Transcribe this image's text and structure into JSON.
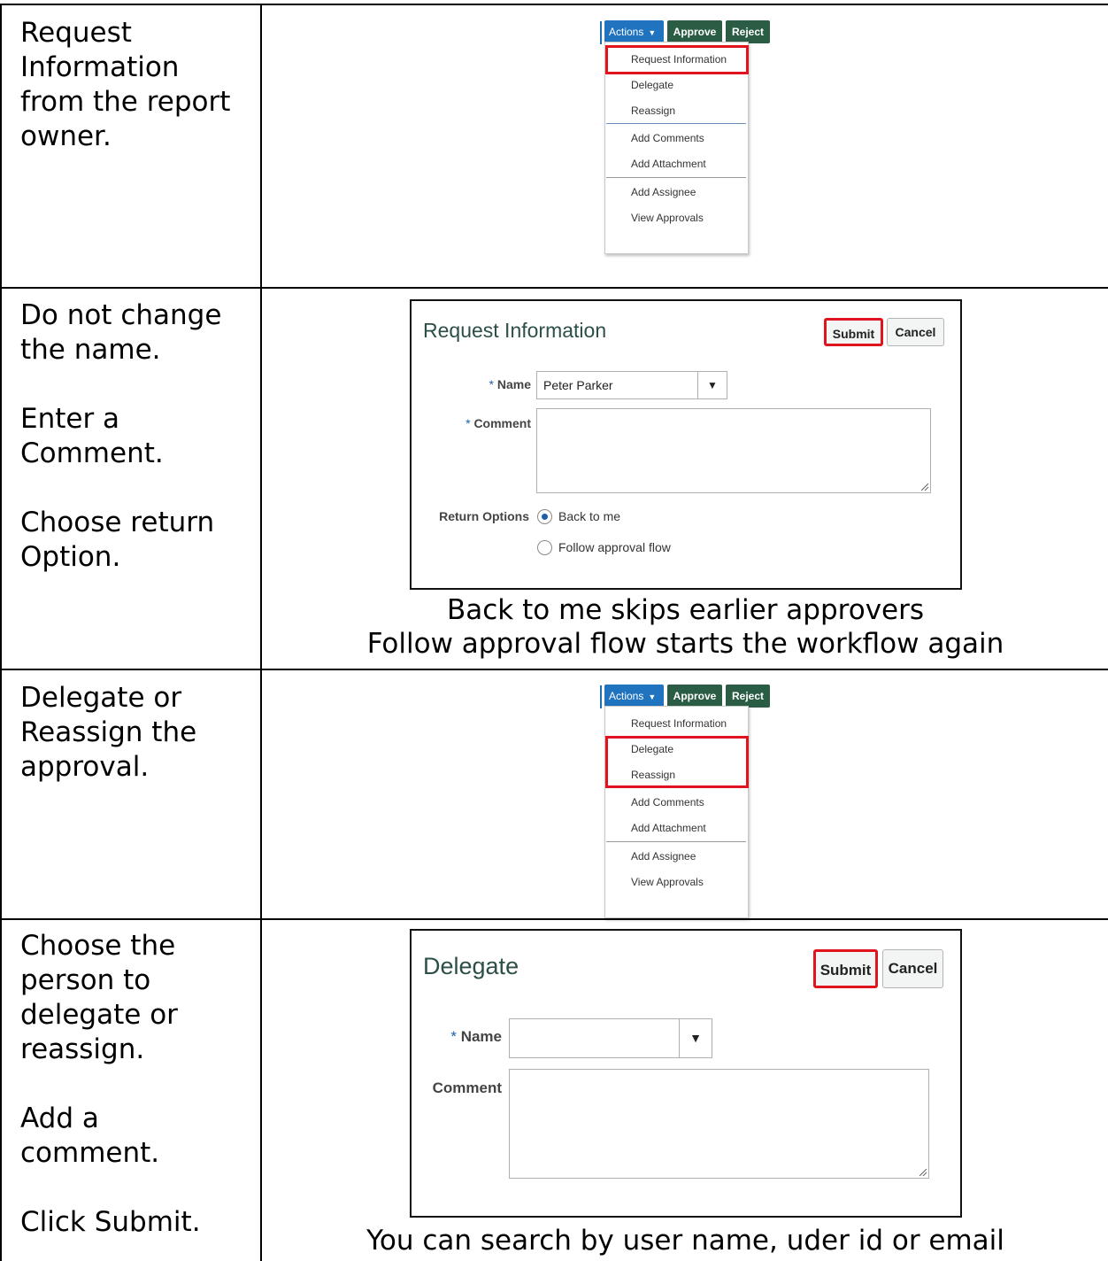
{
  "rows": [
    {
      "instruction": [
        "Request",
        "Information",
        "from the report",
        "owner."
      ]
    },
    {
      "instruction": [
        "Do not change",
        "the name."
      ],
      "instruction_2": [
        "Enter a",
        "Comment."
      ],
      "instruction_3": [
        "Choose return",
        "Option."
      ],
      "caption_1": "Back to me skips earlier approvers",
      "caption_2": "Follow approval flow starts the workflow again"
    },
    {
      "instruction": [
        "Delegate or",
        "Reassign the",
        "approval."
      ]
    },
    {
      "instruction": [
        "Choose the",
        "person to",
        "delegate or",
        "reassign."
      ],
      "instruction_2": [
        "Add a",
        "comment."
      ],
      "instruction_3": [
        "Click Submit."
      ],
      "caption_1": "You can search by user name, uder id or email"
    }
  ],
  "actions_menu": {
    "actions_label": "Actions",
    "approve_label": "Approve",
    "reject_label": "Reject",
    "items": [
      "Request Information",
      "Delegate",
      "Reassign",
      "Add Comments",
      "Add Attachment",
      "Add Assignee",
      "View Approvals"
    ]
  },
  "request_info_dialog": {
    "title": "Request Information",
    "submit_label": "Submit",
    "cancel_label": "Cancel",
    "name_label": "Name",
    "name_value": "Peter Parker",
    "comment_label": "Comment",
    "comment_value": "",
    "return_options_label": "Return Options",
    "options": [
      "Back to me",
      "Follow approval flow"
    ],
    "selected_option": "Back to me"
  },
  "delegate_dialog": {
    "title": "Delegate",
    "submit_label": "Submit",
    "cancel_label": "Cancel",
    "name_label": "Name",
    "name_value": "",
    "comment_label": "Comment",
    "comment_value": ""
  },
  "colors": {
    "actions_blue": "#1f73bf",
    "approve_green": "#2b5d44",
    "highlight_red": "#e0141e",
    "title_green": "#2c4f47",
    "required_blue": "#1c5fa8"
  },
  "icons": {
    "dropdown_caret": "caret-down-icon",
    "select_arrow": "triangle-down-icon",
    "resize_grip": "resize-grip-icon"
  }
}
